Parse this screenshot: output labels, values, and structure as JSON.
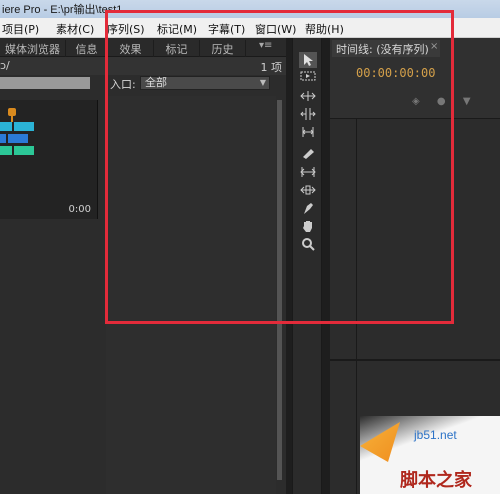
{
  "window": {
    "title": "iere Pro - E:\\pr输出\\test1"
  },
  "menu": [
    {
      "label": "项目(P)"
    },
    {
      "label": "素材(C)"
    },
    {
      "label": "序列(S)"
    },
    {
      "label": "标记(M)"
    },
    {
      "label": "字幕(T)"
    },
    {
      "label": "窗口(W)"
    },
    {
      "label": "帮助(H)"
    }
  ],
  "left_tabs": [
    {
      "label": "媒体浏览器"
    },
    {
      "label": "信息"
    },
    {
      "label": "效果"
    },
    {
      "label": "标记"
    },
    {
      "label": "历史"
    }
  ],
  "project": {
    "name": "ɔ/",
    "items_count": "1 项",
    "entry_label": "入口:",
    "entry_value": "全部",
    "thumb_duration": "0:00"
  },
  "tools": [
    {
      "icon": "selection-tool-icon"
    },
    {
      "icon": "track-select-tool-icon"
    },
    {
      "icon": "ripple-edit-tool-icon"
    },
    {
      "icon": "rolling-edit-tool-icon"
    },
    {
      "icon": "rate-stretch-tool-icon"
    },
    {
      "icon": "razor-tool-icon"
    },
    {
      "icon": "slip-tool-icon"
    },
    {
      "icon": "slide-tool-icon"
    },
    {
      "icon": "pen-tool-icon"
    },
    {
      "icon": "hand-tool-icon"
    },
    {
      "icon": "zoom-tool-icon"
    }
  ],
  "timeline": {
    "tab_label": "时间线: (没有序列)",
    "timecode": "00:00:00:00"
  },
  "watermark": {
    "site": "jb51.net",
    "name": "脚本之家"
  },
  "colors": {
    "highlight": "#e32b3a",
    "timecode": "#d4a04a"
  }
}
